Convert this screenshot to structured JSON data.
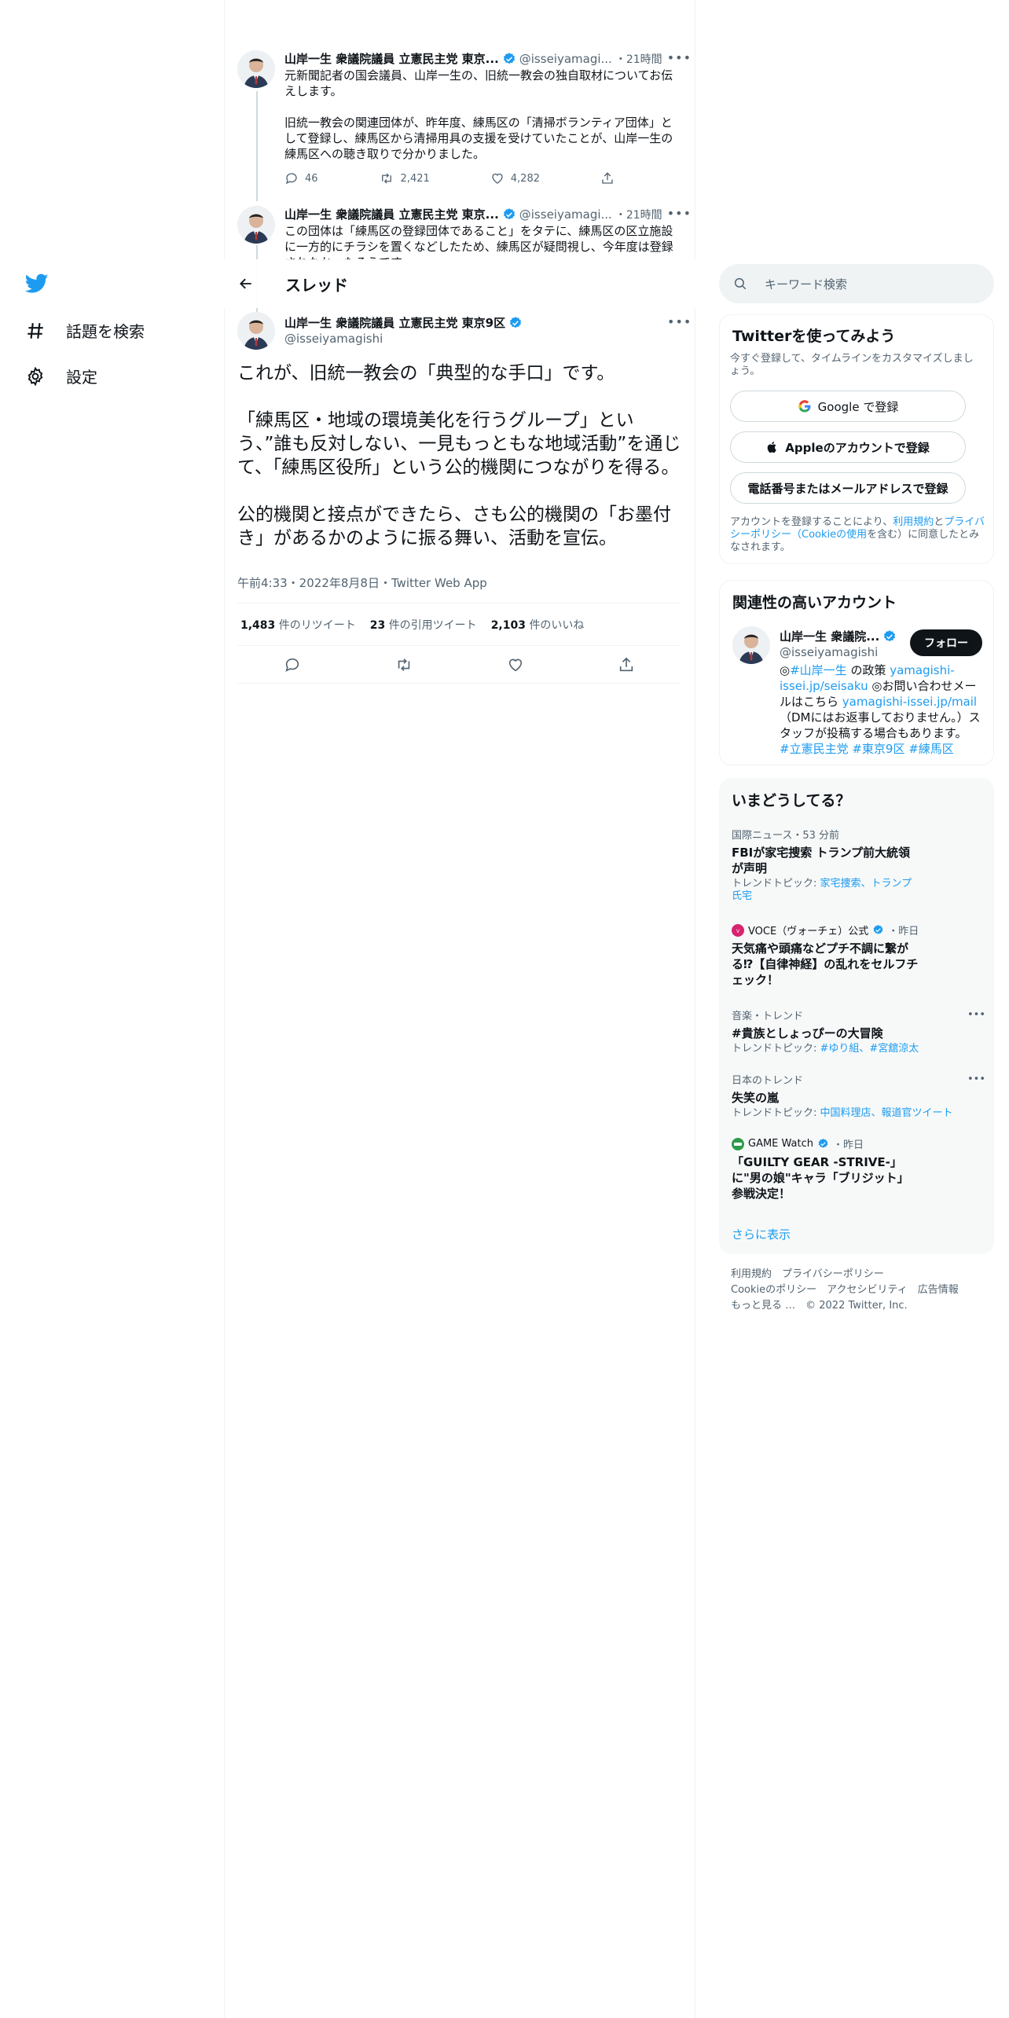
{
  "nav": {
    "items": [
      {
        "label": "話題を検索",
        "icon": "hashtag-icon"
      },
      {
        "label": "設定",
        "icon": "gear-icon"
      }
    ]
  },
  "tweets": [
    {
      "name": "山岸一生 衆議院議員 立憲民主党 東京...",
      "handle": "@isseiyamagi...",
      "time": "・21時間",
      "text1": "元新聞記者の国会議員、山岸一生の、旧統一教会の独自取材についてお伝えします。",
      "text2": "旧統一教会の関連団体が、昨年度、練馬区の「清掃ボランティア団体」として登録し、練馬区から清掃用具の支援を受けていたことが、山岸一生の練馬区への聴き取りで分かりました。",
      "replies": "46",
      "retweets": "2,421",
      "likes": "4,282"
    },
    {
      "name": "山岸一生 衆議院議員 立憲民主党 東京...",
      "handle": "@isseiyamagi...",
      "time": "・21時間",
      "text1": "この団体は「練馬区の登録団体であること」をタテに、練馬区の区立施設に一方的にチラシを置くなどしたため、練馬区が疑問視し、今年度は登録されなかったそうです。"
    }
  ],
  "thread": {
    "title": "スレッド"
  },
  "main_tweet": {
    "name": "山岸一生 衆議院議員 立憲民主党 東京9区",
    "handle": "@isseiyamagishi",
    "p1": "これが、旧統一教会の「典型的な手口」です。",
    "p2": "「練馬区・地域の環境美化を行うグループ」という、”誰も反対しない、一見もっともな地域活動”を通じて、「練馬区役所」という公的機関につながりを得る。",
    "p3": "公的機関と接点ができたら、さも公的機関の「お墨付き」があるかのように振る舞い、活動を宣伝。",
    "meta": "午前4:33・2022年8月8日・Twitter Web App",
    "retweets_count": "1,483",
    "retweets_label": "件のリツイート",
    "quotes_count": "23",
    "quotes_label": "件の引用ツイート",
    "likes_count": "2,103",
    "likes_label": "件のいいね"
  },
  "search": {
    "placeholder": "キーワード検索"
  },
  "signup": {
    "title": "Twitterを使ってみよう",
    "desc": "今すぐ登録して、タイムラインをカスタマイズしましょう。",
    "google": "Google で登録",
    "apple": "Appleのアカウントで登録",
    "phone": "電話番号またはメールアドレスで登録",
    "terms_a": "アカウントを登録することにより、",
    "terms_link1": "利用規約",
    "terms_b": "と",
    "terms_link2": "プライバシーポリシー（Cookieの使用",
    "terms_c": "を含む）に同意したとみなされます。"
  },
  "related": {
    "title": "関連性の高いアカウント",
    "name": "山岸一生 衆議院...",
    "handle": "@isseiyamagishi",
    "follow": "フォロー",
    "bio_1": "◎",
    "bio_tag1": "#山岸一生",
    "bio_2": " の政策 ",
    "bio_link1": "yamagishi-issei.jp/seisaku",
    "bio_3": " ◎お問い合わせメールはこちら ",
    "bio_link2": "yamagishi-issei.jp/mail",
    "bio_4": "（DMにはお返事しておりません。）スタッフが投稿する場合もあります。",
    "bio_tags": "#立憲民主党 #東京9区 #練馬区"
  },
  "trends": {
    "title": "いまどうしてる？",
    "items": [
      {
        "context": "国際ニュース・53 分前",
        "title": "FBIが家宅捜索 トランプ前大統領が声明",
        "sub_label": "トレンドトピック: ",
        "sub_links": "家宅捜索、トランプ氏宅"
      },
      {
        "context_name": "VOCE（ヴォーチェ）公式",
        "context_time": "・昨日",
        "title": "天気痛や頭痛などプチ不調に繋がる⁉【自律神経】の乱れをセルフチェック！"
      },
      {
        "context": "音楽・トレンド",
        "title": "#貴族としょっぴーの大冒険",
        "sub_label": "トレンドトピック: ",
        "sub_links": "#ゆり組、#宮舘涼太"
      },
      {
        "context": "日本のトレンド",
        "title": "失笑の嵐",
        "sub_label": "トレンドトピック: ",
        "sub_links": "中国料理店、報道官ツイート"
      },
      {
        "context_name": "GAME Watch",
        "context_time": "・昨日",
        "title": "「GUILTY GEAR -STRIVE-」に\"男の娘\"キャラ「ブリジット」参戦決定！"
      }
    ],
    "more": "さらに表示"
  },
  "footer": {
    "line1": "利用規約　プライバシーポリシー",
    "line2": "Cookieのポリシー　アクセシビリティ　広告情報",
    "line3": "もっと見る …　© 2022 Twitter, Inc."
  },
  "colors": {
    "accent": "#1d9bf0",
    "text": "#0f1419",
    "muted": "#536471",
    "panel": "#f7f9f9"
  }
}
